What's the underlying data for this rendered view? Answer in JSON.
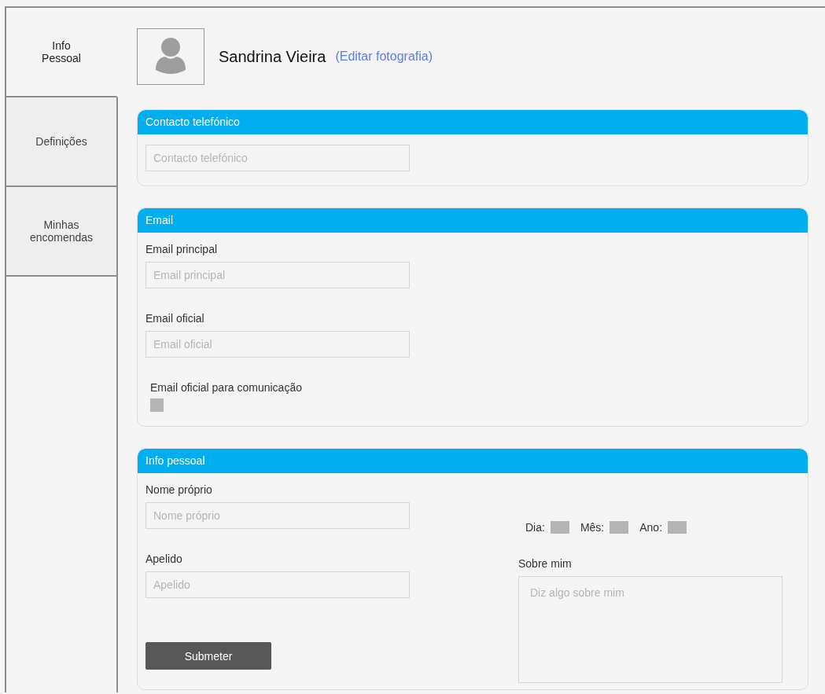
{
  "sidebar": {
    "tabs": [
      {
        "label": "Info\nPessoal",
        "selected": true
      },
      {
        "label": "Definições",
        "selected": false
      },
      {
        "label": "Minhas\nencomendas",
        "selected": false
      }
    ]
  },
  "profile": {
    "name": "Sandrina Vieira",
    "edit_link": "(Editar fotografia)"
  },
  "phone_section": {
    "title": "Contacto telefónico",
    "field": {
      "placeholder": "Contacto telefónico"
    }
  },
  "email_section": {
    "title": "Email",
    "fields": [
      {
        "label": "Email principal",
        "placeholder": "Email principal"
      },
      {
        "label": "Email oficial",
        "placeholder": "Email oficial"
      }
    ],
    "checkbox": {
      "label": "Email oficial para comunicação",
      "checked": false
    }
  },
  "personal_section": {
    "title": "Info pessoal",
    "first_name": {
      "label": "Nome próprio",
      "placeholder": "Nome próprio"
    },
    "last_name": {
      "label": "Apelido",
      "placeholder": "Apelido"
    },
    "date_parts": [
      {
        "label": "Dia:"
      },
      {
        "label": "Mês:"
      },
      {
        "label": "Ano:"
      }
    ],
    "about": {
      "label": "Sobre mim",
      "placeholder": "Diz algo sobre mim"
    },
    "submit": "Submeter"
  }
}
